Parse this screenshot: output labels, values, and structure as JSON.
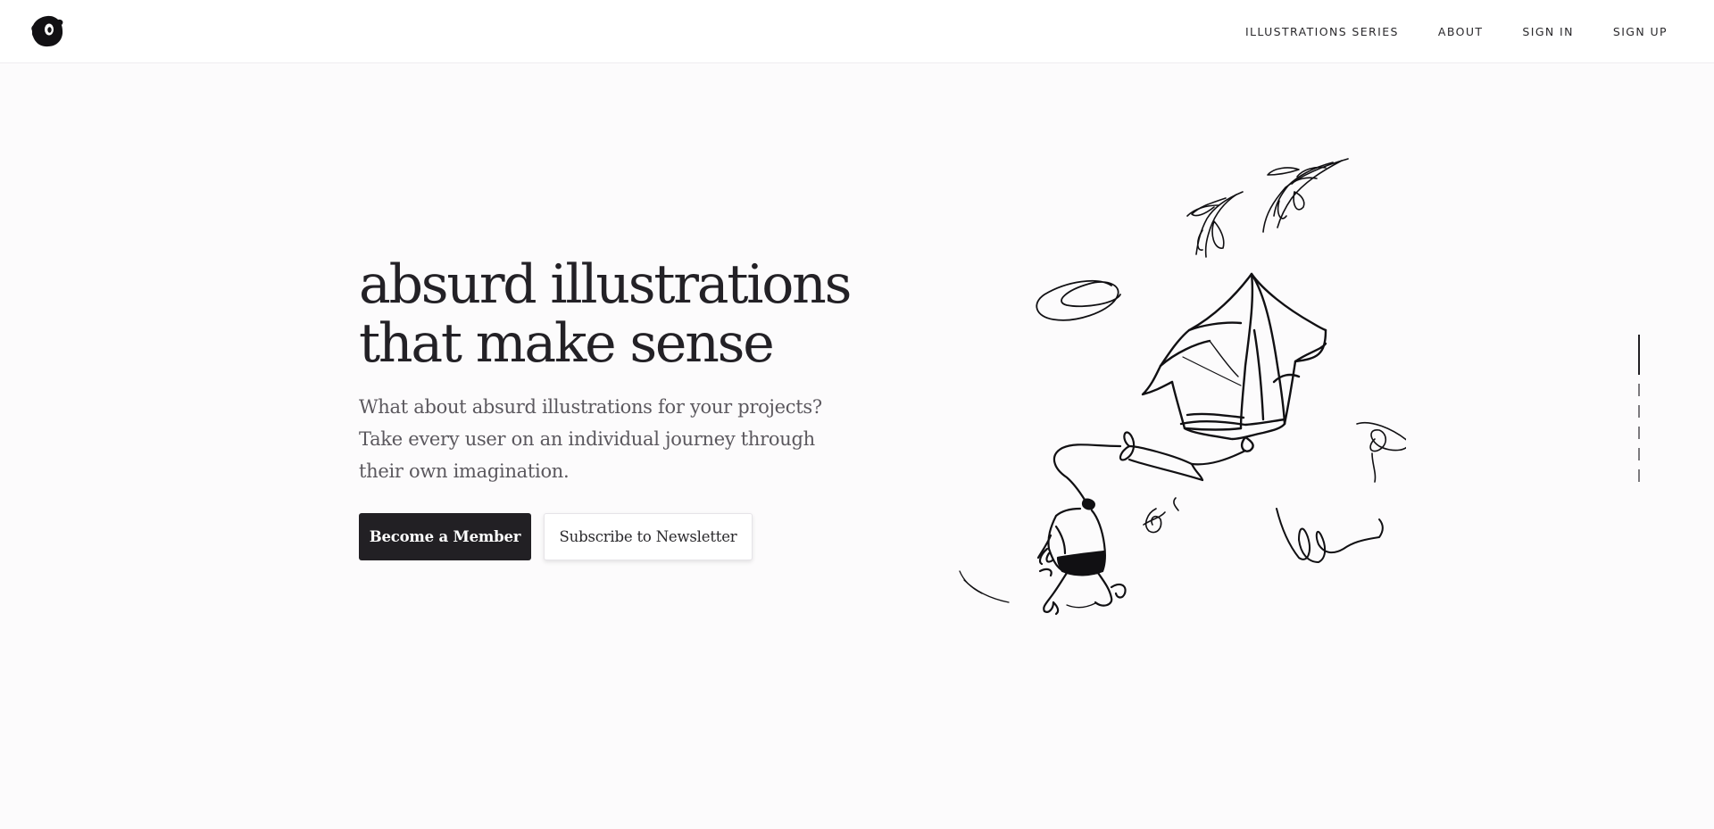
{
  "header": {
    "logo_name": "splash-logo-icon",
    "nav": [
      {
        "label": "ILLUSTRATIONS SERIES"
      },
      {
        "label": "ABOUT"
      },
      {
        "label": "SIGN IN"
      },
      {
        "label": "SIGN UP"
      }
    ]
  },
  "hero": {
    "title_line1": "absurd illustrations",
    "title_line2": "that make sense",
    "subtitle_line1": "What about absurd illustrations for your projects?",
    "subtitle_line2": "Take every user on an individual journey through",
    "subtitle_line3": "their own imagination.",
    "primary_button": "Become a Member",
    "secondary_button": "Subscribe to Newsletter"
  },
  "illustration": {
    "icon": "sketch-house-kite-illustration"
  },
  "scroll_indicator": {
    "sections": 5,
    "active_section": 1
  },
  "colors": {
    "background": "#fcfbfc",
    "text_dark": "#232126",
    "text_muted": "#5b585e",
    "button_dark": "#222024"
  }
}
